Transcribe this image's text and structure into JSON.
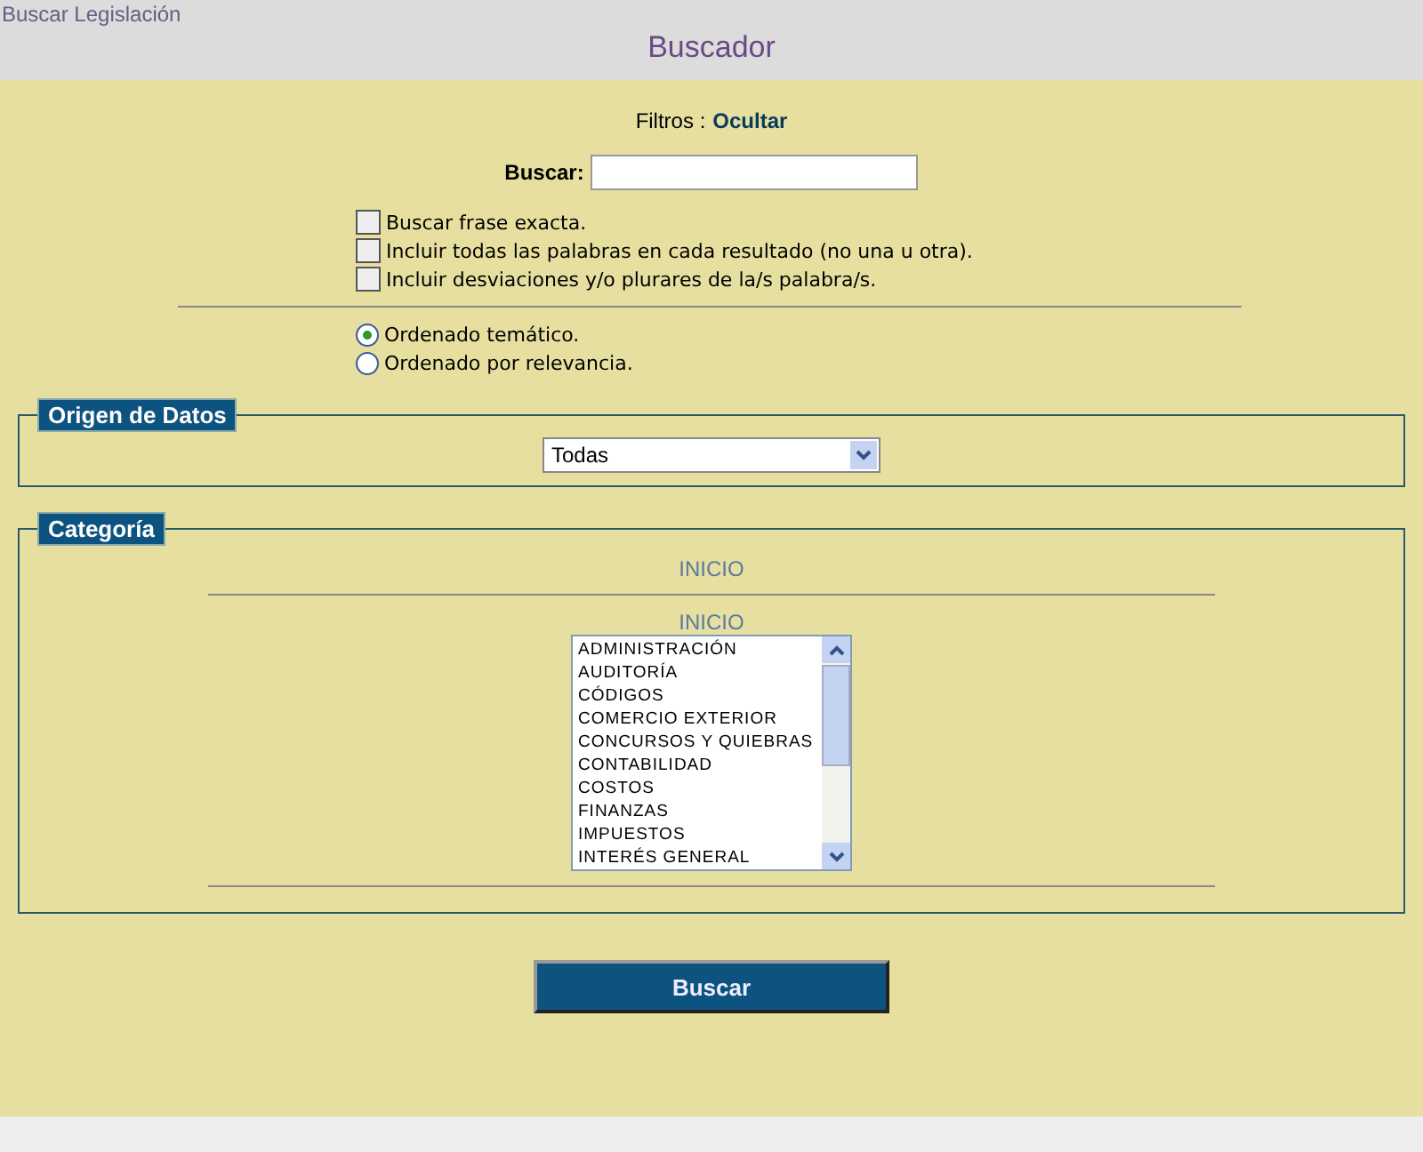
{
  "breadcrumb": "Buscar Legislación",
  "title": "Buscador",
  "filters": {
    "label": "Filtros :",
    "toggle": "Ocultar"
  },
  "search": {
    "label": "Buscar:"
  },
  "options": [
    {
      "label": "Buscar frase exacta.",
      "checked": false
    },
    {
      "label": "Incluir todas las palabras en cada resultado (no una u otra).",
      "checked": false
    },
    {
      "label": "Incluir desviaciones y/o plurares de la/s palabra/s.",
      "checked": false
    }
  ],
  "sort": [
    {
      "label": "Ordenado temático.",
      "selected": true
    },
    {
      "label": "Ordenado por relevancia.",
      "selected": false
    }
  ],
  "origin": {
    "legend": "Origen de Datos",
    "value": "Todas"
  },
  "category": {
    "legend": "Categoría",
    "path": "INICIO",
    "list_title": "INICIO",
    "items": [
      "ADMINISTRACIÓN",
      "AUDITORÍA",
      "CÓDIGOS",
      "COMERCIO EXTERIOR",
      "CONCURSOS Y QUIEBRAS",
      "CONTABILIDAD",
      "COSTOS",
      "FINANZAS",
      "IMPUESTOS",
      "INTERÉS GENERAL"
    ]
  },
  "submit": "Buscar"
}
